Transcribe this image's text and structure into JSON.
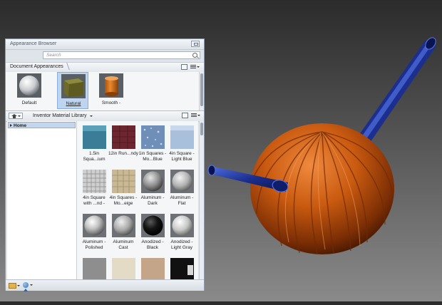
{
  "browser": {
    "title": "Appearance Browser",
    "search_placeholder": "Search",
    "document_tab": "Document Appearances",
    "library_name": "Inventor Material Library",
    "tree_home": "Home"
  },
  "document_items": [
    {
      "label": "Default",
      "swatch": "sphere-white"
    },
    {
      "label": "Natural",
      "swatch": "cube-olive",
      "selected": true
    },
    {
      "label": "Smooth -",
      "swatch": "cylinder-orange"
    }
  ],
  "library_items": [
    {
      "label": "1.5in Squa...ium",
      "swatch": "cube-teal"
    },
    {
      "label": "12in Run...ndy",
      "swatch": "cube-maroon"
    },
    {
      "label": "1in Squares - Mo...Blue",
      "swatch": "cube-speckled-blue"
    },
    {
      "label": "4in Square - Light Blue",
      "swatch": "cube-light-blue"
    },
    {
      "label": "4in Square with ...nd -",
      "swatch": "cube-white-tile"
    },
    {
      "label": "4in Squares - Mo...eige",
      "swatch": "cube-beige-tile"
    },
    {
      "label": "Aluminum - Dark",
      "swatch": "sphere-dark-metal"
    },
    {
      "label": "Aluminum - Flat",
      "swatch": "sphere-flat-metal"
    },
    {
      "label": "Aluminum - Polished",
      "swatch": "sphere-polished"
    },
    {
      "label": "Aluminum Cast",
      "swatch": "sphere-cast"
    },
    {
      "label": "Anodized - Black",
      "swatch": "sphere-black"
    },
    {
      "label": "Anodized - Light Gray",
      "swatch": "sphere-light-gray"
    },
    {
      "label": "",
      "swatch": "block-gray"
    },
    {
      "label": "",
      "swatch": "block-cream"
    },
    {
      "label": "",
      "swatch": "block-tan"
    },
    {
      "label": "",
      "swatch": "block-black"
    }
  ],
  "colors": {
    "model_orange": "#c95a10",
    "pipe_blue": "#1c2f8f",
    "selection_blue": "#bfd4ee"
  }
}
